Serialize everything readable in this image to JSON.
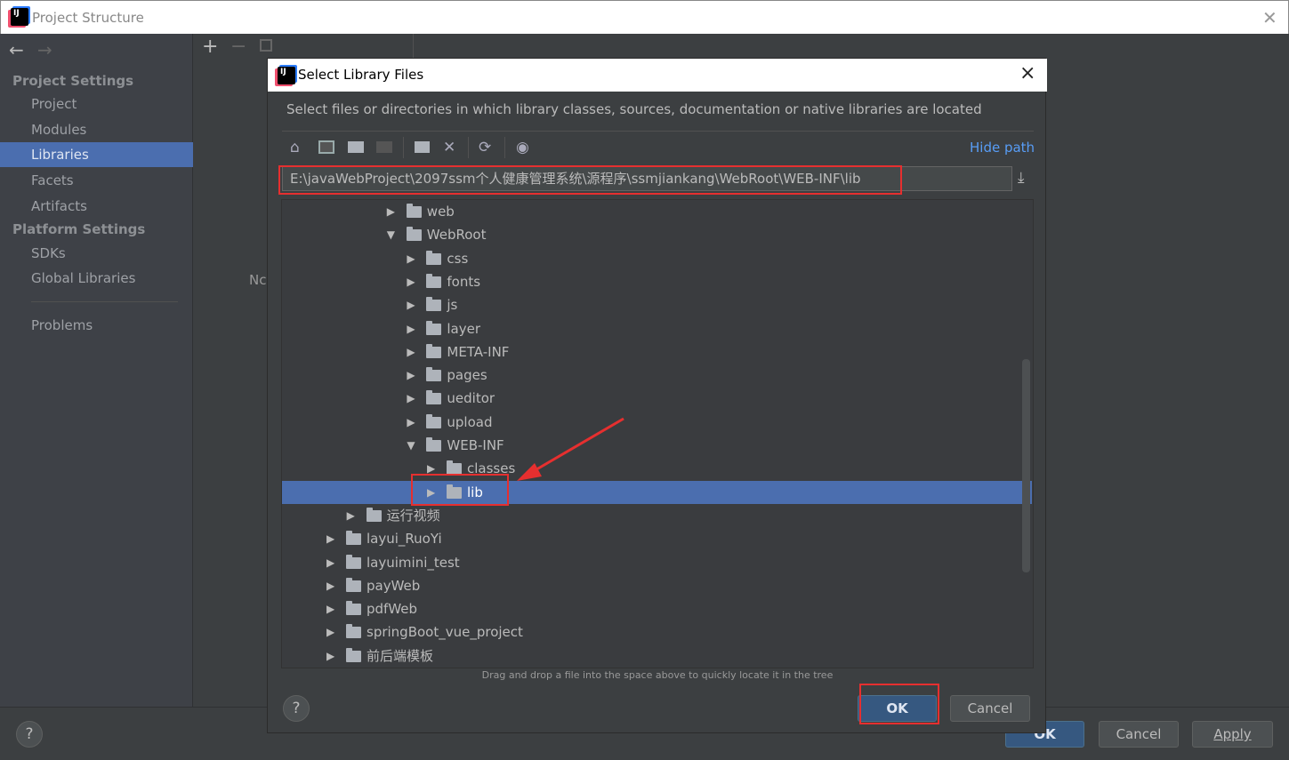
{
  "window": {
    "title": "Project Structure",
    "close_icon": "close-icon"
  },
  "sidebar": {
    "sections": [
      {
        "label": "Project Settings"
      },
      {
        "label": "Platform Settings"
      }
    ],
    "items": [
      {
        "label": "Project"
      },
      {
        "label": "Modules"
      },
      {
        "label": "Libraries",
        "selected": true
      },
      {
        "label": "Facets"
      },
      {
        "label": "Artifacts"
      },
      {
        "label": "SDKs"
      },
      {
        "label": "Global Libraries"
      },
      {
        "label": "Problems"
      }
    ]
  },
  "main": {
    "partial_text": "Nc"
  },
  "footer": {
    "ok": "OK",
    "cancel": "Cancel",
    "apply": "Apply",
    "help": "?"
  },
  "dialog": {
    "title": "Select Library Files",
    "description": "Select files or directories in which library classes, sources, documentation or native libraries are located",
    "hide_path": "Hide path",
    "path": "E:\\javaWebProject\\2097ssm个人健康管理系统\\源程序\\ssmjiankang\\WebRoot\\WEB-INF\\lib",
    "tree": [
      {
        "label": "web",
        "level": 3,
        "expanded": false
      },
      {
        "label": "WebRoot",
        "level": 3,
        "expanded": true
      },
      {
        "label": "css",
        "level": 4,
        "expanded": false
      },
      {
        "label": "fonts",
        "level": 4,
        "expanded": false
      },
      {
        "label": "js",
        "level": 4,
        "expanded": false
      },
      {
        "label": "layer",
        "level": 4,
        "expanded": false
      },
      {
        "label": "META-INF",
        "level": 4,
        "expanded": false
      },
      {
        "label": "pages",
        "level": 4,
        "expanded": false
      },
      {
        "label": "ueditor",
        "level": 4,
        "expanded": false
      },
      {
        "label": "upload",
        "level": 4,
        "expanded": false
      },
      {
        "label": "WEB-INF",
        "level": 4,
        "expanded": true
      },
      {
        "label": "classes",
        "level": 5,
        "expanded": false
      },
      {
        "label": "lib",
        "level": 5,
        "expanded": false,
        "selected": true
      },
      {
        "label": "运行视频",
        "level": 1,
        "expanded": false
      },
      {
        "label": "layui_RuoYi",
        "level": 0,
        "expanded": false
      },
      {
        "label": "layuimini_test",
        "level": 0,
        "expanded": false
      },
      {
        "label": "payWeb",
        "level": 0,
        "expanded": false
      },
      {
        "label": "pdfWeb",
        "level": 0,
        "expanded": false
      },
      {
        "label": "springBoot_vue_project",
        "level": 0,
        "expanded": false
      },
      {
        "label": "前后端模板",
        "level": 0,
        "expanded": false
      }
    ],
    "drag_hint": "Drag and drop a file into the space above to quickly locate it in the tree",
    "ok": "OK",
    "cancel": "Cancel",
    "help": "?"
  },
  "colors": {
    "selection": "#4b6eaf",
    "default_button": "#365880",
    "annotation": "#e62f2f",
    "link": "#589df6"
  }
}
